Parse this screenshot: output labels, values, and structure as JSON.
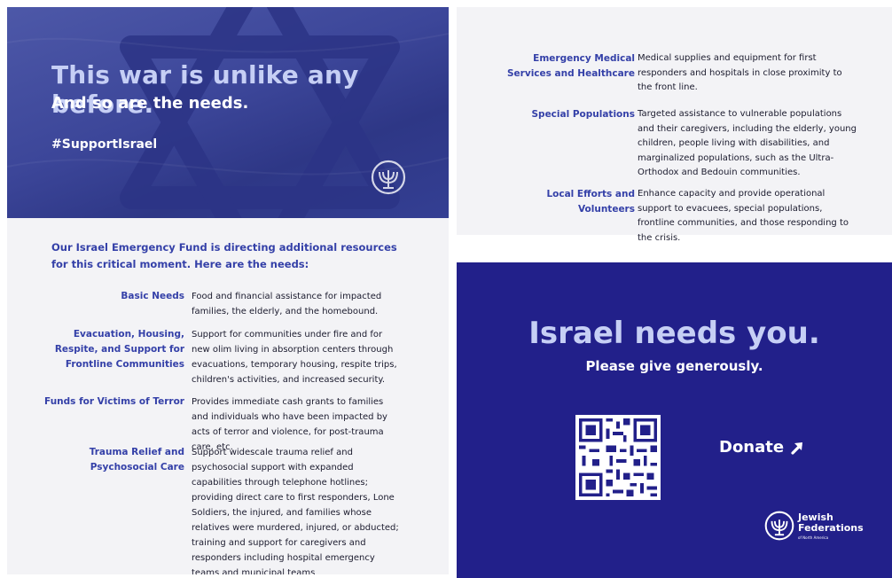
{
  "hero": {
    "title": "This war is unlike any before.",
    "subtitle": "And so are the needs.",
    "hashtag": "#SupportIsrael",
    "logo_icon": "menorah-logo-icon",
    "background_color": "#3c4699",
    "title_color": "#c6cff5"
  },
  "intro": "Our Israel Emergency Fund is directing additional resources for this critical moment. Here are the needs:",
  "needs": [
    {
      "label": "Basic Needs",
      "description": "Food and financial assistance for impacted families, the elderly, and the homebound."
    },
    {
      "label": "Evacuation, Housing, Respite, and Support for Frontline Communities",
      "description": "Support for communities under fire and for new olim living in absorption centers through evacuations, temporary housing, respite trips, children's activities, and increased security."
    },
    {
      "label": "Funds for Victims of Terror",
      "description": "Provides immediate cash grants to families and individuals who have been impacted by acts of terror and violence, for post-trauma care, etc."
    },
    {
      "label": "Trauma Relief and Psychosocial Care",
      "description": "Support widescale trauma relief and psychosocial support with expanded capabilities through telephone hotlines; providing direct care to first responders, Lone Soldiers, the injured, and families whose relatives were murdered, injured, or abducted; training and support for caregivers and responders including hospital emergency teams and municipal teams"
    }
  ],
  "more_needs": [
    {
      "label": "Emergency Medical Services and Healthcare",
      "description": "Medical supplies and equipment for first responders and hospitals in close proximity to the front line."
    },
    {
      "label": "Special Populations",
      "description": "Targeted assistance to vulnerable populations and their caregivers, including the elderly, young children, people living with disabilities, and marginalized populations, such as the Ultra-Orthodox and Bedouin communities."
    },
    {
      "label": "Local Efforts and Volunteers",
      "description": "Enhance capacity and provide operational support to evacuees, special populations, frontline communities, and those responding to the crisis."
    }
  ],
  "cta": {
    "title": "Israel needs you.",
    "subtitle": "Please give generously.",
    "qr_icon": "qr-code-icon",
    "donate_label": "Donate",
    "donate_icon": "arrow-up-right-icon",
    "background_color": "#22208a"
  },
  "org": {
    "name": "Jewish Federations",
    "tagline": "of North America",
    "logo_icon": "menorah-logo-icon"
  },
  "colors": {
    "accent_blue": "#3440a8",
    "light_panel": "#f3f3f6",
    "body_text": "#1b1b2e"
  }
}
